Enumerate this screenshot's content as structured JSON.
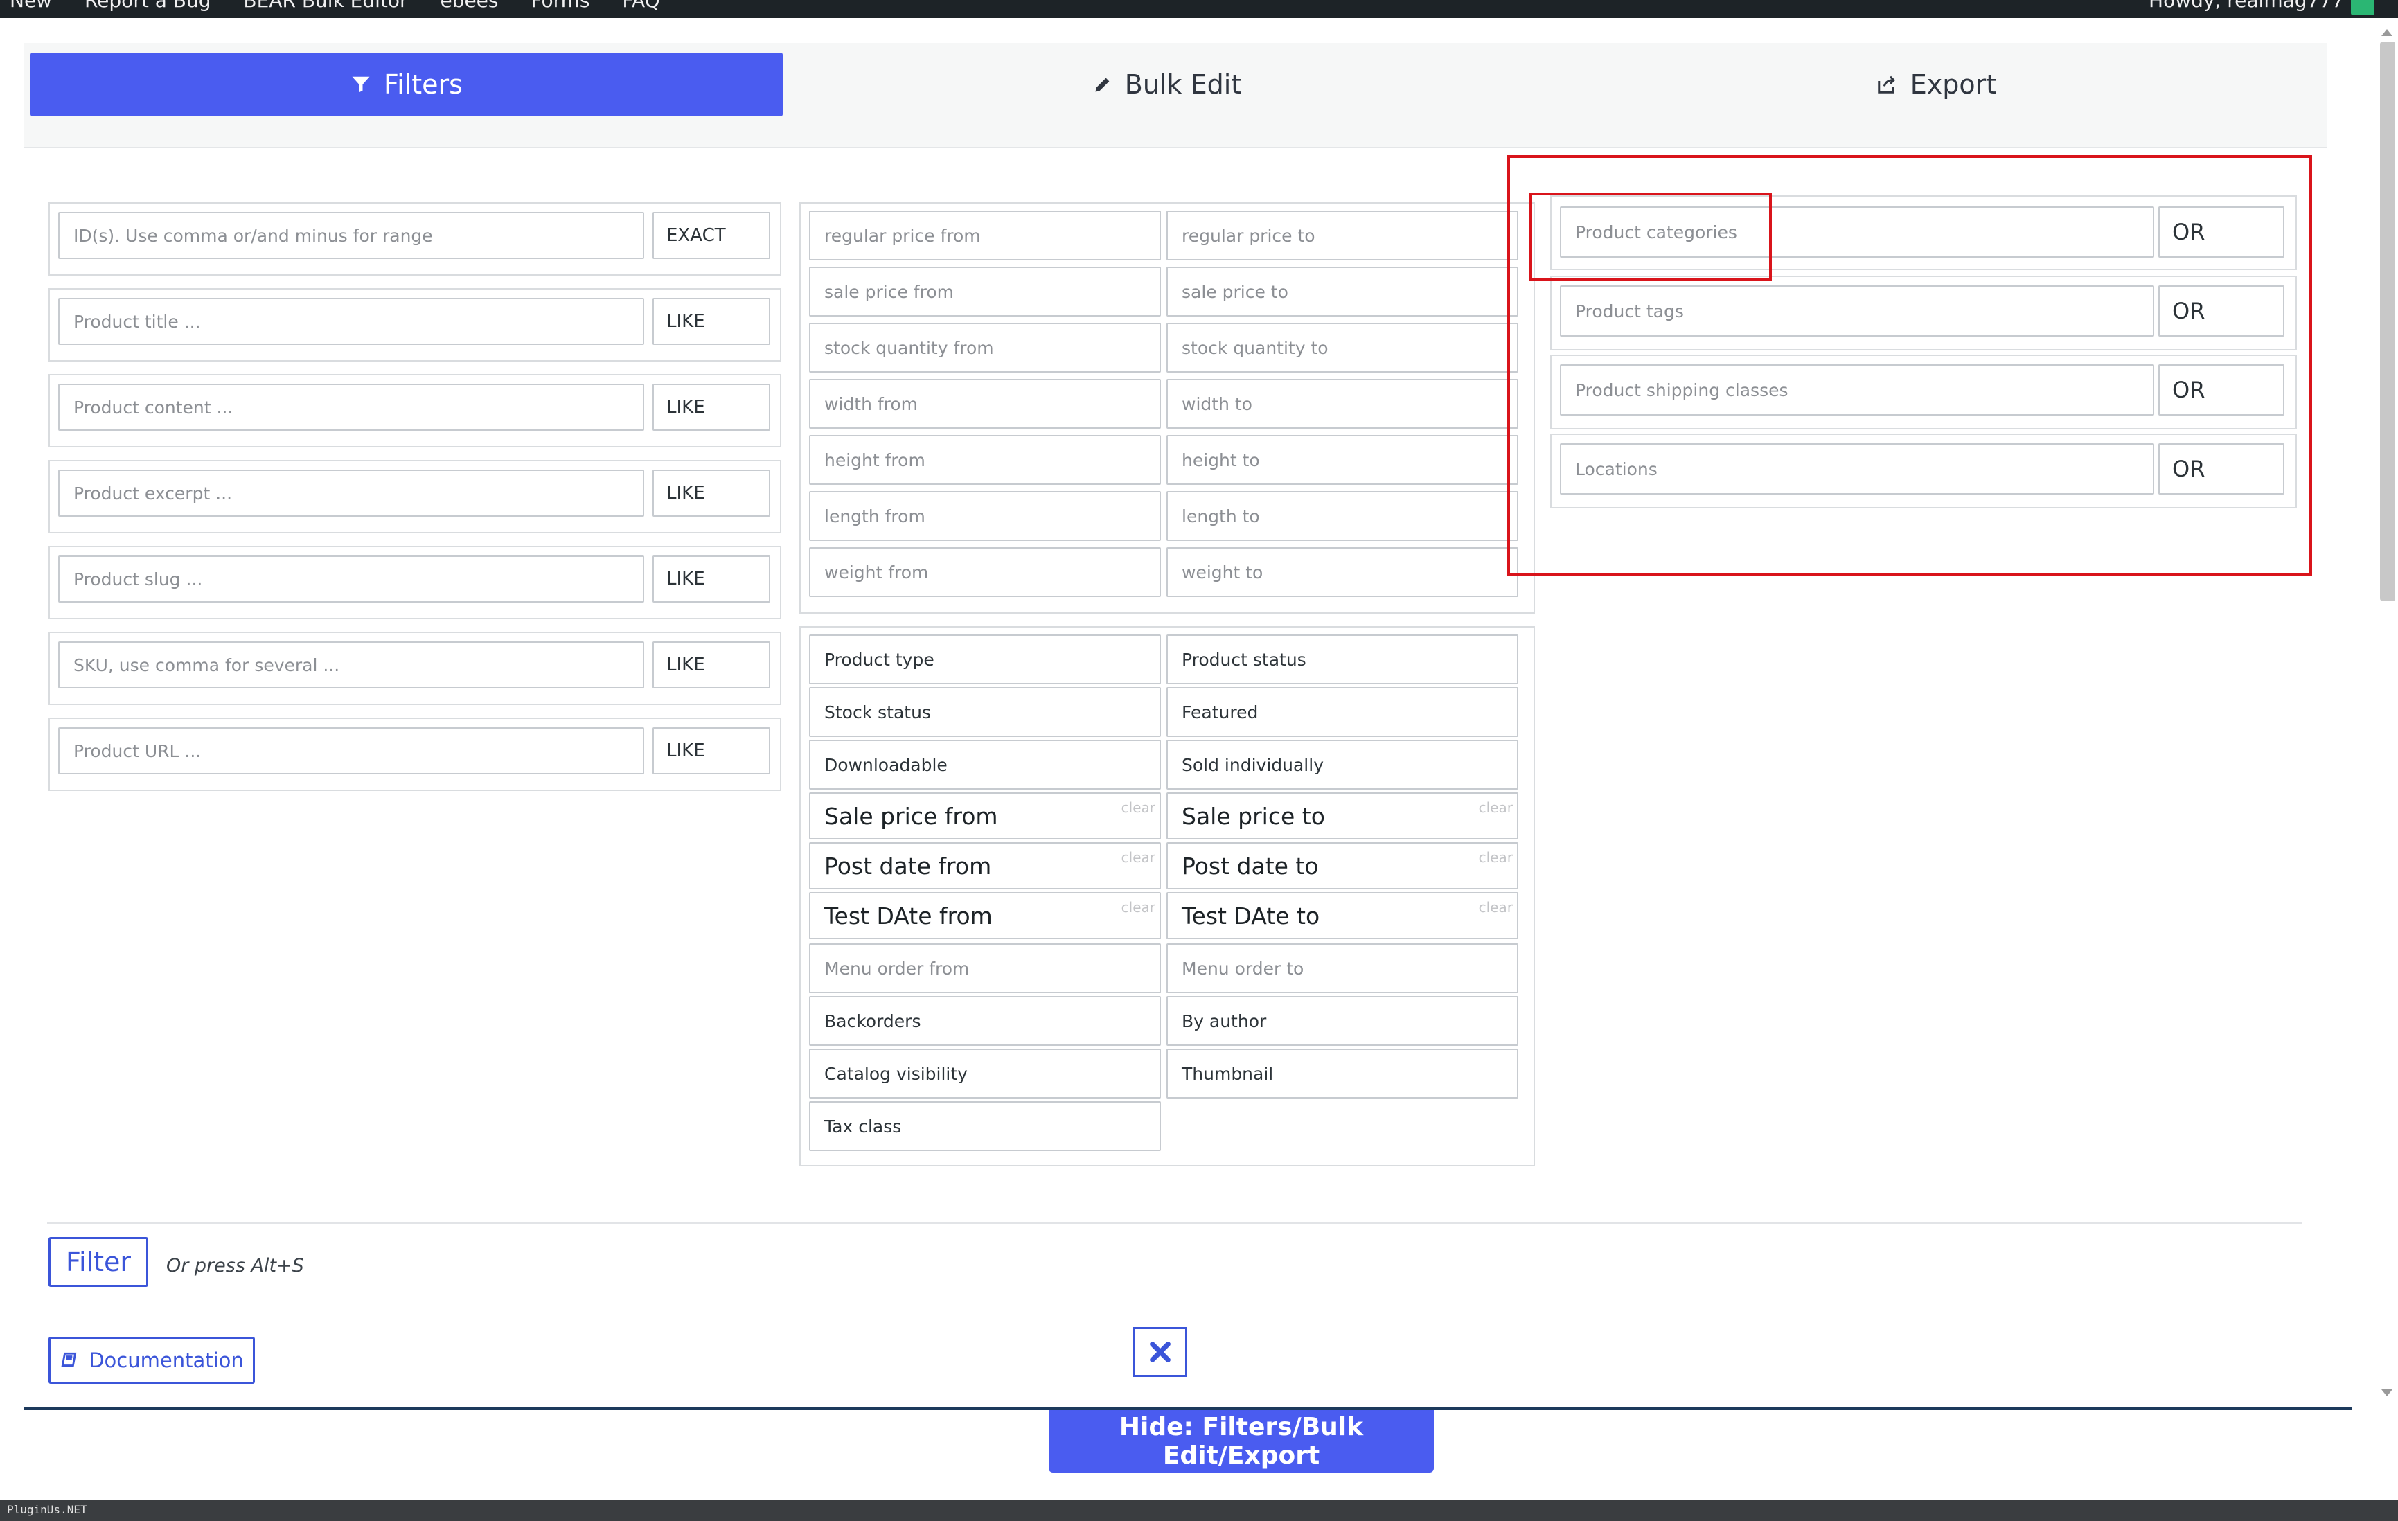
{
  "adminbar": {
    "items": [
      "New",
      "Report a Bug",
      "BEAR Bulk Editor",
      "ebees",
      "Forms",
      "FAQ"
    ],
    "greeting": "Howdy, realmag777"
  },
  "tabs": [
    {
      "label": "Filters",
      "icon": "filter-icon",
      "active": true
    },
    {
      "label": "Bulk Edit",
      "icon": "pencil-icon",
      "active": false
    },
    {
      "label": "Export",
      "icon": "export-icon",
      "active": false
    }
  ],
  "text_filters": [
    {
      "placeholder": "ID(s). Use comma or/and minus for range",
      "op": "EXACT"
    },
    {
      "placeholder": "Product title ...",
      "op": "LIKE"
    },
    {
      "placeholder": "Product content ...",
      "op": "LIKE"
    },
    {
      "placeholder": "Product excerpt ...",
      "op": "LIKE"
    },
    {
      "placeholder": "Product slug ...",
      "op": "LIKE"
    },
    {
      "placeholder": "SKU, use comma for several ...",
      "op": "LIKE"
    },
    {
      "placeholder": "Product URL ...",
      "op": "LIKE"
    }
  ],
  "range_filters": [
    {
      "from": "regular price from",
      "to": "regular price to"
    },
    {
      "from": "sale price from",
      "to": "sale price to"
    },
    {
      "from": "stock quantity from",
      "to": "stock quantity to"
    },
    {
      "from": "width from",
      "to": "width to"
    },
    {
      "from": "height from",
      "to": "height to"
    },
    {
      "from": "length from",
      "to": "length to"
    },
    {
      "from": "weight from",
      "to": "weight to"
    }
  ],
  "select_filters": {
    "row1": [
      "Product type",
      "Product status"
    ],
    "row2": [
      "Stock status",
      "Featured"
    ],
    "row3": [
      "Downloadable",
      "Sold individually"
    ],
    "date1": [
      "Sale price from",
      "Sale price to"
    ],
    "date2": [
      "Post date from",
      "Post date to"
    ],
    "date3": [
      "Test DAte from",
      "Test DAte to"
    ],
    "menu_order": [
      "Menu order from",
      "Menu order to"
    ],
    "row4": [
      "Backorders",
      "By author"
    ],
    "row5": [
      "Catalog visibility",
      "Thumbnail"
    ],
    "row6": [
      "Tax class"
    ],
    "clear_label": "clear"
  },
  "taxonomy_filters": [
    {
      "placeholder": "Product categories",
      "op": "OR"
    },
    {
      "placeholder": "Product tags",
      "op": "OR"
    },
    {
      "placeholder": "Product shipping classes",
      "op": "OR"
    },
    {
      "placeholder": "Locations",
      "op": "OR"
    }
  ],
  "actions": {
    "filter_label": "Filter",
    "hint": "Or press Alt+S",
    "documentation_label": "Documentation",
    "hide_label": "Hide: Filters/Bulk Edit/Export"
  },
  "footer_text": "PluginUs.NET",
  "colors": {
    "accent": "#4a5cf0",
    "outline": "#3b55d9",
    "highlight": "#d9141b"
  }
}
